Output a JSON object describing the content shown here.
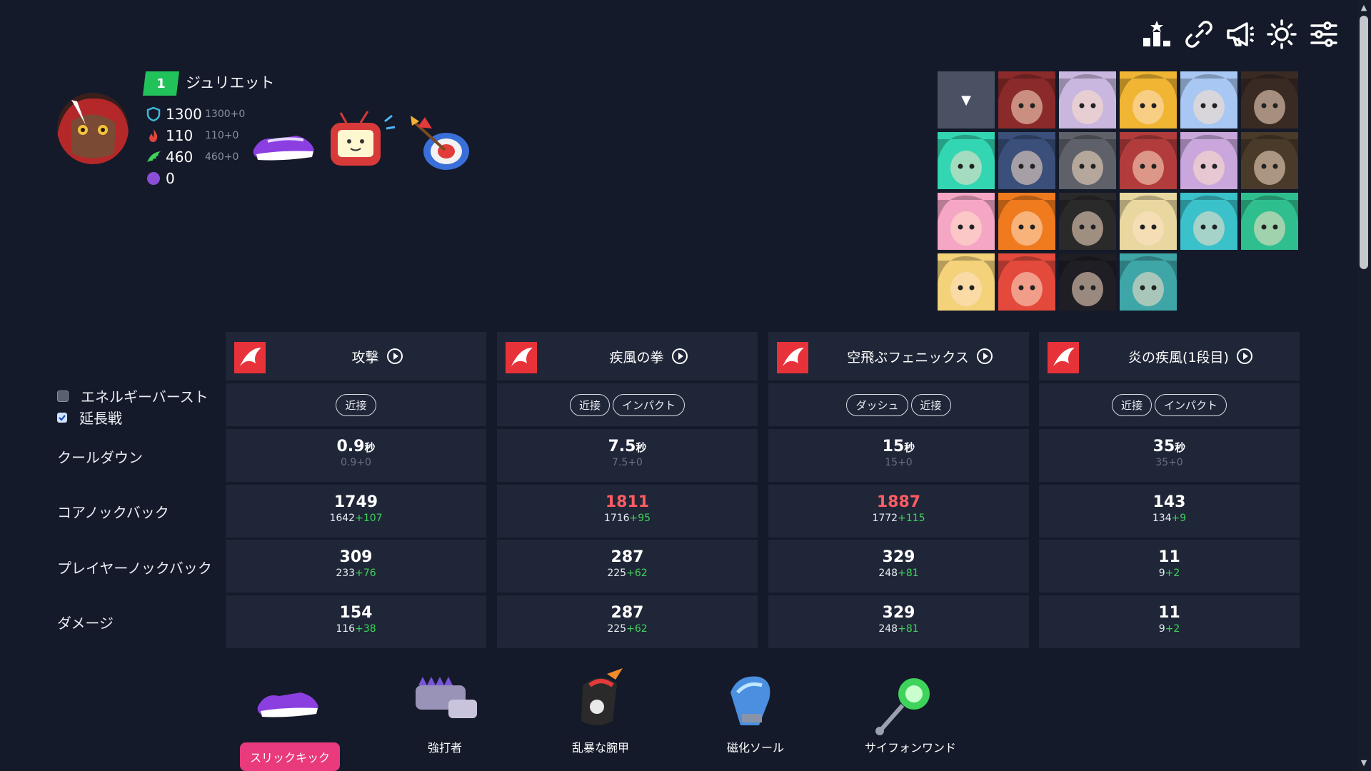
{
  "toolbar": {
    "icons": [
      "leaderboard-icon",
      "link-icon",
      "megaphone-icon",
      "brightness-icon",
      "settings-sliders-icon"
    ]
  },
  "character": {
    "level": "1",
    "name": "ジュリエット",
    "stats": [
      {
        "icon": "shield-icon",
        "value": "1300",
        "sub": "1300+0",
        "color": "#3fb7d9"
      },
      {
        "icon": "fire-icon",
        "value": "110",
        "sub": "110+0",
        "color": "#e2453c"
      },
      {
        "icon": "wing-icon",
        "value": "460",
        "sub": "460+0",
        "color": "#3ed35a"
      },
      {
        "icon": "orb-icon",
        "value": "0",
        "sub": "",
        "color": "#8a4fd6"
      }
    ],
    "equipped": [
      "shoe-icon",
      "tv-icon",
      "dartboard-icon"
    ]
  },
  "roster": {
    "dropdown": "▼",
    "portraits": [
      "#8b2a2a",
      "#c9b7df",
      "#f0b532",
      "#a8c7f2",
      "#3a2a24",
      "#33d6b2",
      "#3a4f7a",
      "#5e6169",
      "#b23c3c",
      "#c9a7dc",
      "#4a3a2a",
      "#f5a6c5",
      "#f07a1e",
      "#2a2a2a",
      "#e9d7a0",
      "#3ac1c9",
      "#2fbf8f",
      "#f3d27a",
      "#e34a3c",
      "#1e1e24",
      "#3fa6a8"
    ]
  },
  "options": {
    "energy_burst": {
      "label": "エネルギーバースト",
      "checked": false
    },
    "overtime": {
      "label": "延長戦",
      "checked": true
    }
  },
  "row_labels": {
    "cooldown": "クールダウン",
    "core_knockback": "コアノックバック",
    "player_knockback": "プレイヤーノックバック",
    "damage": "ダメージ"
  },
  "skills": [
    {
      "name": "攻撃",
      "tags": [
        "近接"
      ],
      "cooldown": {
        "main": "0.9",
        "unit": "秒",
        "sub": "0.9+0"
      },
      "core": {
        "main": "1749",
        "red": false,
        "base": "1642",
        "plus": "+107"
      },
      "player": {
        "main": "309",
        "base": "233",
        "plus": "+76"
      },
      "damage": {
        "main": "154",
        "base": "116",
        "plus": "+38"
      }
    },
    {
      "name": "疾風の拳",
      "tags": [
        "近接",
        "インパクト"
      ],
      "cooldown": {
        "main": "7.5",
        "unit": "秒",
        "sub": "7.5+0"
      },
      "core": {
        "main": "1811",
        "red": true,
        "base": "1716",
        "plus": "+95"
      },
      "player": {
        "main": "287",
        "base": "225",
        "plus": "+62"
      },
      "damage": {
        "main": "287",
        "base": "225",
        "plus": "+62"
      }
    },
    {
      "name": "空飛ぶフェニックス",
      "tags": [
        "ダッシュ",
        "近接"
      ],
      "cooldown": {
        "main": "15",
        "unit": "秒",
        "sub": "15+0"
      },
      "core": {
        "main": "1887",
        "red": true,
        "base": "1772",
        "plus": "+115"
      },
      "player": {
        "main": "329",
        "base": "248",
        "plus": "+81"
      },
      "damage": {
        "main": "329",
        "base": "248",
        "plus": "+81"
      }
    },
    {
      "name": "炎の疾風(1段目)",
      "tags": [
        "近接",
        "インパクト"
      ],
      "cooldown": {
        "main": "35",
        "unit": "秒",
        "sub": "35+0"
      },
      "core": {
        "main": "143",
        "red": false,
        "base": "134",
        "plus": "+9"
      },
      "player": {
        "main": "11",
        "base": "9",
        "plus": "+2"
      },
      "damage": {
        "main": "11",
        "base": "9",
        "plus": "+2"
      }
    }
  ],
  "items": [
    {
      "label": "スリックキック",
      "selected": true,
      "icon": "shoe-icon"
    },
    {
      "label": "強打者",
      "selected": false,
      "icon": "spiked-gauntlet-icon"
    },
    {
      "label": "乱暴な腕甲",
      "selected": false,
      "icon": "bracer-icon"
    },
    {
      "label": "磁化ソール",
      "selected": false,
      "icon": "magnet-boot-icon"
    },
    {
      "label": "サイフォンワンド",
      "selected": false,
      "icon": "wand-icon"
    }
  ],
  "colors": {
    "accent": "#22c25a",
    "selected": "#e83a7c",
    "panel": "#1f2637",
    "background": "#141a29",
    "highlight_red": "#ff5c63",
    "plus_green": "#3ed35a"
  }
}
